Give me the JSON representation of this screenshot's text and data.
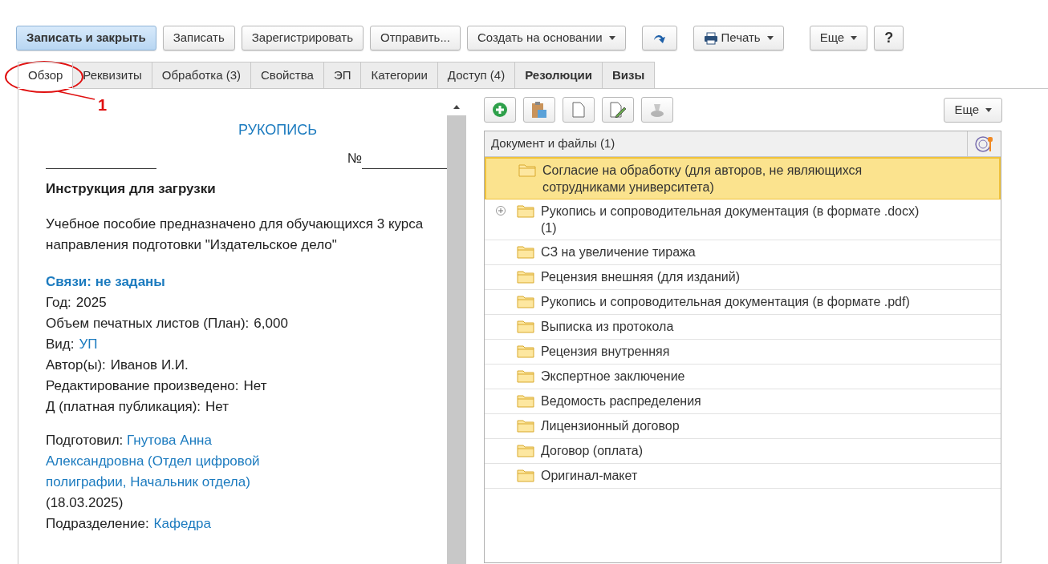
{
  "toolbar": [
    {
      "label": "Записать и закрыть",
      "kind": "primary",
      "dropdown": false
    },
    {
      "label": "Записать",
      "kind": "normal",
      "dropdown": false
    },
    {
      "label": "Зарегистрировать",
      "kind": "normal",
      "dropdown": false
    },
    {
      "label": "Отправить...",
      "kind": "normal",
      "dropdown": false
    },
    {
      "label": "Создать на основании",
      "kind": "normal",
      "dropdown": true
    },
    {
      "kind": "arrow"
    },
    {
      "label": "Печать",
      "kind": "print",
      "dropdown": true
    },
    {
      "label": "Еще",
      "kind": "normal",
      "dropdown": true
    },
    {
      "label": "?",
      "kind": "help",
      "dropdown": false
    }
  ],
  "tabs": [
    {
      "label": "Обзор",
      "selected": true,
      "bold": false
    },
    {
      "label": "Реквизиты",
      "selected": false,
      "bold": false
    },
    {
      "label": "Обработка (3)",
      "selected": false,
      "bold": false
    },
    {
      "label": "Свойства",
      "selected": false,
      "bold": false
    },
    {
      "label": "ЭП",
      "selected": false,
      "bold": false
    },
    {
      "label": "Категории",
      "selected": false,
      "bold": false
    },
    {
      "label": "Доступ (4)",
      "selected": false,
      "bold": false
    },
    {
      "label": "Резолюции",
      "selected": false,
      "bold": true
    },
    {
      "label": "Визы",
      "selected": false,
      "bold": true
    }
  ],
  "annotation": {
    "label": "1"
  },
  "overview": {
    "heading": "РУКОПИСЬ",
    "number_label": "№",
    "title": "Инструкция для загрузки",
    "description": "Учебное пособие предназначено для обучающихся 3 курса направления подготовки \"Издательское дело\"",
    "links_label": "Связи: не заданы",
    "fields": [
      {
        "label": "Год:",
        "value": "2025",
        "link": false
      },
      {
        "label": "Объем печатных листов (План):",
        "value": "6,000",
        "link": false
      },
      {
        "label": "Вид:",
        "value": "УП",
        "link": true
      },
      {
        "label": "Автор(ы):",
        "value": "Иванов И.И.",
        "link": false
      },
      {
        "label": "Редактирование произведено:",
        "value": "Нет",
        "link": false
      },
      {
        "label": "Д (платная публикация):",
        "value": "Нет",
        "link": false
      }
    ],
    "prepared": {
      "label": "Подготовил:",
      "value": "Гнутова Анна Александровна (Отдел цифровой полиграфии, Начальник отдела)",
      "date": "(18.03.2025)"
    },
    "department": {
      "label": "Подразделение:",
      "value": "Кафедра",
      "link": true
    }
  },
  "files": {
    "more_button": "Еще",
    "column": "Документ и файлы (1)",
    "rows": [
      {
        "label": "Согласие на обработку (для авторов, не являющихся сотрудниками университета)",
        "selected": true,
        "expandable": false
      },
      {
        "label": "Рукопись и сопроводительная документация (в формате .docx) (1)",
        "selected": false,
        "expandable": true
      },
      {
        "label": "СЗ на увеличение тиража",
        "selected": false,
        "expandable": false
      },
      {
        "label": "Рецензия внешняя (для изданий)",
        "selected": false,
        "expandable": false
      },
      {
        "label": "Рукопись и сопроводительная документация (в формате .pdf)",
        "selected": false,
        "expandable": false
      },
      {
        "label": "Выписка из протокола",
        "selected": false,
        "expandable": false
      },
      {
        "label": "Рецензия внутренняя",
        "selected": false,
        "expandable": false
      },
      {
        "label": "Экспертное заключение",
        "selected": false,
        "expandable": false
      },
      {
        "label": "Ведомость распределения",
        "selected": false,
        "expandable": false
      },
      {
        "label": "Лицензионный договор",
        "selected": false,
        "expandable": false
      },
      {
        "label": "Договор (оплата)",
        "selected": false,
        "expandable": false
      },
      {
        "label": "Оригинал-макет",
        "selected": false,
        "expandable": false
      }
    ]
  }
}
